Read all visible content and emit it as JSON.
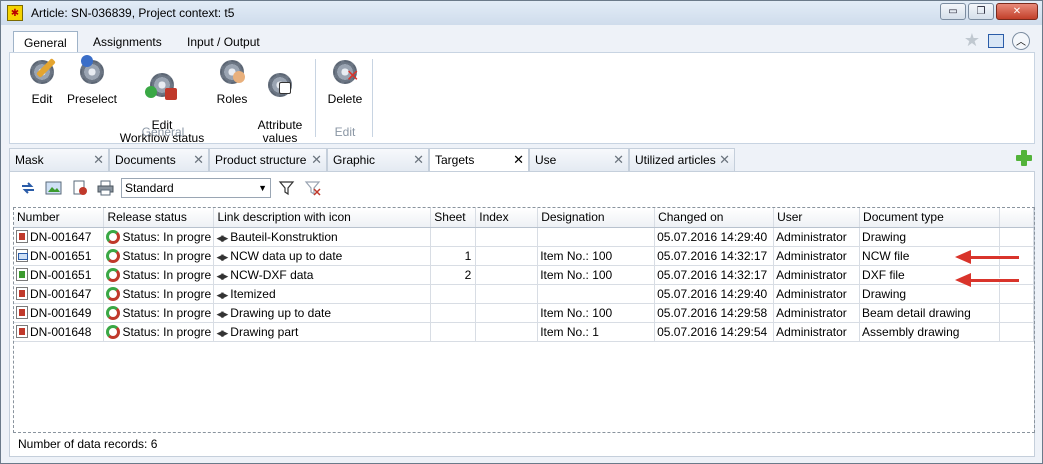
{
  "window": {
    "title": "Article: SN-036839, Project context: t5",
    "minimize_glyph": "▭",
    "restore_glyph": "❐",
    "close_glyph": "✕"
  },
  "ribbon_tabs": [
    {
      "label": "General",
      "active": true
    },
    {
      "label": "Assignments",
      "active": false
    },
    {
      "label": "Input / Output",
      "active": false
    }
  ],
  "ribbon": {
    "buttons": [
      {
        "label": "Edit"
      },
      {
        "label": "Preselect"
      },
      {
        "label": "Edit\nWorkflow status"
      },
      {
        "label": "Roles"
      },
      {
        "label": "Attribute\nvalues"
      },
      {
        "label": "Delete"
      }
    ],
    "groups": [
      {
        "label": "General"
      },
      {
        "label": "Edit"
      }
    ]
  },
  "doc_tabs": [
    {
      "label": "Mask",
      "active": false
    },
    {
      "label": "Documents",
      "active": false
    },
    {
      "label": "Product structure",
      "active": false
    },
    {
      "label": "Graphic",
      "active": false
    },
    {
      "label": "Targets",
      "active": true
    },
    {
      "label": "Use",
      "active": false
    },
    {
      "label": "Utilized articles",
      "active": false
    }
  ],
  "toolbar": {
    "view_select_value": "Standard"
  },
  "table": {
    "columns": [
      "Number",
      "Release status",
      "Link description with icon",
      "Sheet",
      "Index",
      "Designation",
      "Changed on",
      "User",
      "Document type"
    ],
    "rows": [
      {
        "icon": "drawing",
        "number": "DN-001647",
        "status": "Status: In progre",
        "link": "Bauteil-Konstruktion",
        "sheet": "",
        "index": "",
        "designation": "",
        "changed": "05.07.2016 14:29:40",
        "user": "Administrator",
        "doctype": "Drawing"
      },
      {
        "icon": "ncw",
        "number": "DN-001651",
        "status": "Status: In progre",
        "link": "NCW data up to date",
        "sheet": "1",
        "index": "",
        "designation": "Item No.: 100",
        "changed": "05.07.2016 14:32:17",
        "user": "Administrator",
        "doctype": "NCW file"
      },
      {
        "icon": "dxf",
        "number": "DN-001651",
        "status": "Status: In progre",
        "link": "NCW-DXF data",
        "sheet": "2",
        "index": "",
        "designation": "Item No.: 100",
        "changed": "05.07.2016 14:32:17",
        "user": "Administrator",
        "doctype": "DXF file"
      },
      {
        "icon": "drawing",
        "number": "DN-001647",
        "status": "Status: In progre",
        "link": "Itemized",
        "sheet": "",
        "index": "",
        "designation": "",
        "changed": "05.07.2016 14:29:40",
        "user": "Administrator",
        "doctype": "Drawing"
      },
      {
        "icon": "drawing",
        "number": "DN-001649",
        "status": "Status: In progre",
        "link": "Drawing up to date",
        "sheet": "",
        "index": "",
        "designation": "Item No.: 100",
        "changed": "05.07.2016 14:29:58",
        "user": "Administrator",
        "doctype": "Beam detail drawing"
      },
      {
        "icon": "drawing",
        "number": "DN-001648",
        "status": "Status: In progre",
        "link": "Drawing part",
        "sheet": "",
        "index": "",
        "designation": "Item No.: 1",
        "changed": "05.07.2016 14:29:54",
        "user": "Administrator",
        "doctype": "Assembly drawing"
      }
    ]
  },
  "status_bar": {
    "text": "Number of data records: 6"
  },
  "colors": {
    "annotation_arrow": "#d9342b",
    "add_icon": "#52b33a"
  }
}
